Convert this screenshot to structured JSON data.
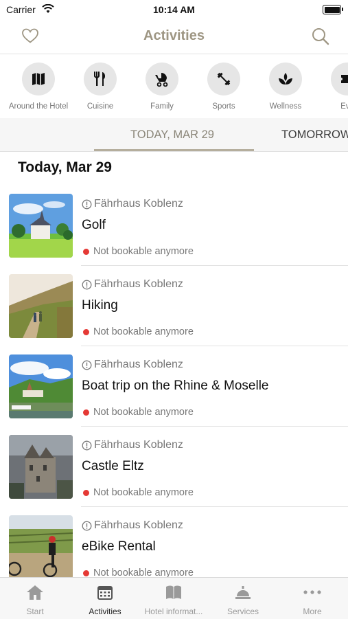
{
  "status_bar": {
    "carrier": "Carrier",
    "time": "10:14 AM"
  },
  "header": {
    "title": "Activities"
  },
  "categories": [
    {
      "label": "Around the Hotel",
      "icon": "map-icon"
    },
    {
      "label": "Cuisine",
      "icon": "fork-knife-icon"
    },
    {
      "label": "Family",
      "icon": "stroller-icon"
    },
    {
      "label": "Sports",
      "icon": "dumbbell-icon"
    },
    {
      "label": "Wellness",
      "icon": "lotus-icon"
    },
    {
      "label": "Eve",
      "icon": "ticket-icon"
    }
  ],
  "date_tabs": [
    {
      "label": "TODAY, MAR 29",
      "selected": true
    },
    {
      "label": "TOMORROW"
    }
  ],
  "section_title": "Today, Mar 29",
  "activities": [
    {
      "venue": "Fährhaus Koblenz",
      "name": "Golf",
      "status": "Not bookable anymore"
    },
    {
      "venue": "Fährhaus Koblenz",
      "name": "Hiking",
      "status": "Not bookable anymore"
    },
    {
      "venue": "Fährhaus Koblenz",
      "name": "Boat trip on the Rhine & Moselle",
      "status": "Not bookable anymore"
    },
    {
      "venue": "Fährhaus Koblenz",
      "name": "Castle Eltz",
      "status": "Not bookable anymore"
    },
    {
      "venue": "Fährhaus Koblenz",
      "name": "eBike Rental",
      "status": "Not bookable anymore"
    }
  ],
  "tab_bar": [
    {
      "label": "Start",
      "icon": "home-icon"
    },
    {
      "label": "Activities",
      "icon": "calendar-icon",
      "active": true
    },
    {
      "label": "Hotel informat...",
      "icon": "book-icon"
    },
    {
      "label": "Services",
      "icon": "service-bell-icon"
    },
    {
      "label": "More",
      "icon": "more-dots-icon"
    }
  ],
  "colors": {
    "accent": "#9e9683",
    "status_red": "#e53935",
    "tab_underline": "#b5ae9d"
  }
}
